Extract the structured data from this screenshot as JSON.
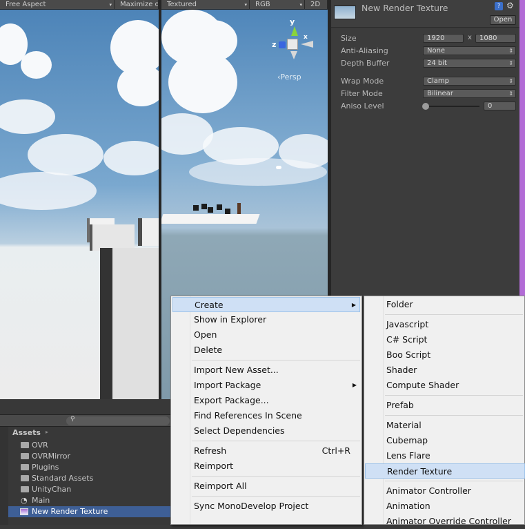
{
  "game_toolbar": {
    "aspect": "Free Aspect",
    "maximize": "Maximize on"
  },
  "scene_toolbar": {
    "shading": "Textured",
    "render_mode": "RGB",
    "mode_2d": "2D"
  },
  "scene": {
    "gizmo_y": "y",
    "gizmo_z": "z",
    "gizmo_x": "x",
    "persp": "‹Persp"
  },
  "inspector": {
    "title": "New Render Texture",
    "open_label": "Open",
    "size_label": "Size",
    "size_w": "1920",
    "size_x": "x",
    "size_h": "1080",
    "aa_label": "Anti-Aliasing",
    "aa_value": "None",
    "depth_label": "Depth Buffer",
    "depth_value": "24 bit",
    "wrap_label": "Wrap Mode",
    "wrap_value": "Clamp",
    "filter_label": "Filter Mode",
    "filter_value": "Bilinear",
    "aniso_label": "Aniso Level",
    "aniso_value": "0"
  },
  "project": {
    "assets_label": "Assets",
    "items": [
      {
        "label": "OVR",
        "icon": "folder-icon"
      },
      {
        "label": "OVRMirror",
        "icon": "folder-icon"
      },
      {
        "label": "Plugins",
        "icon": "folder-icon"
      },
      {
        "label": "Standard Assets",
        "icon": "folder-icon"
      },
      {
        "label": "UnityChan",
        "icon": "folder-icon"
      },
      {
        "label": "Main",
        "icon": "unity-scene-icon"
      },
      {
        "label": "New Render Texture",
        "icon": "render-texture-icon"
      }
    ]
  },
  "context_menu": {
    "create": "Create",
    "show_in_explorer": "Show in Explorer",
    "open": "Open",
    "delete": "Delete",
    "import_new_asset": "Import New Asset...",
    "import_package": "Import Package",
    "export_package": "Export Package...",
    "find_references": "Find References In Scene",
    "select_dependencies": "Select Dependencies",
    "refresh": "Refresh",
    "refresh_shortcut": "Ctrl+R",
    "reimport": "Reimport",
    "reimport_all": "Reimport All",
    "sync_monodevelop": "Sync MonoDevelop Project"
  },
  "create_submenu": {
    "folder": "Folder",
    "javascript": "Javascript",
    "csharp": "C# Script",
    "boo": "Boo Script",
    "shader": "Shader",
    "compute_shader": "Compute Shader",
    "prefab": "Prefab",
    "material": "Material",
    "cubemap": "Cubemap",
    "lens_flare": "Lens Flare",
    "render_texture": "Render Texture",
    "animator_controller": "Animator Controller",
    "animation": "Animation",
    "animator_override": "Animator Override Controller"
  }
}
